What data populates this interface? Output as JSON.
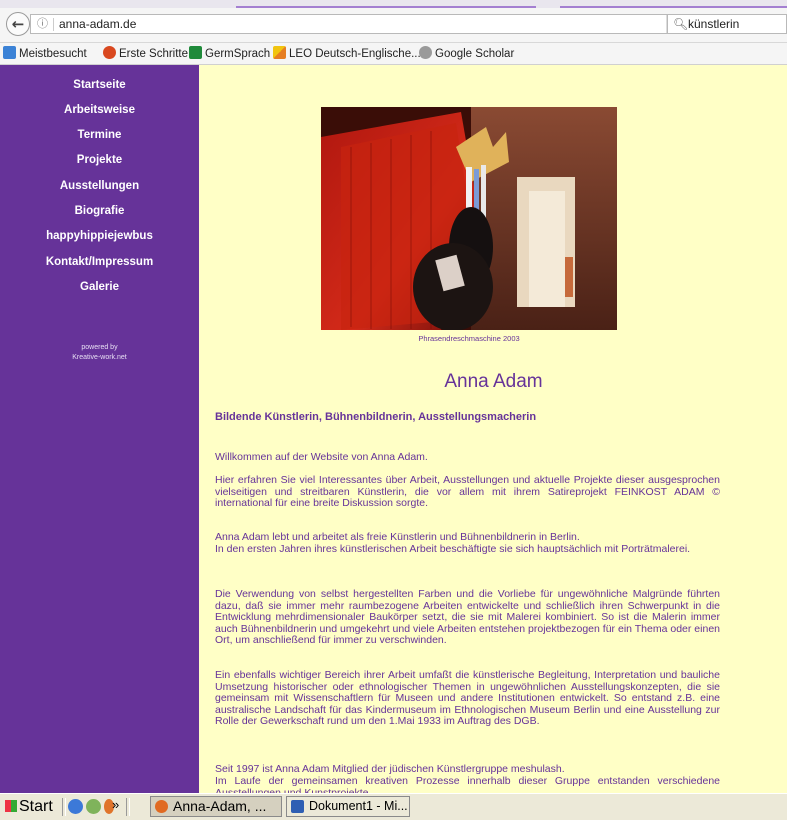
{
  "browser": {
    "url": "anna-adam.de",
    "search_value": "künstlerin",
    "bookmarks": [
      "Meistbesucht",
      "Erste Schritte",
      "GermSprach",
      "LEO Deutsch-Englische...",
      "Google Scholar"
    ]
  },
  "sidebar": {
    "items": [
      "Startseite",
      "Arbeitsweise",
      "Termine",
      "Projekte",
      "Ausstellungen",
      "Biografie",
      "happyhippiejewbus",
      "Kontakt/Impressum",
      "Galerie"
    ],
    "powered_by_1": "powered by",
    "powered_by_2": "Kreative-work.net"
  },
  "main": {
    "caption": "Phrasendreschmaschine 2003",
    "title": "Anna Adam",
    "subtitle": "Bildende Künstlerin, Bühnenbildnerin, Ausstellungsmacherin",
    "paragraphs": [
      "Willkommen auf der Website von Anna Adam.",
      "Hier erfahren Sie viel Interessantes über Arbeit, Ausstellungen und aktuelle Projekte dieser ausgesprochen vielseitigen und streitbaren Künstlerin, die vor allem mit ihrem Satireprojekt FEINKOST ADAM © international für eine breite Diskussion sorgte.",
      "Anna Adam lebt und arbeitet als freie Künstlerin und Bühnenbildnerin in Berlin.",
      "In den ersten Jahren ihres künstlerischen Arbeit beschäftigte sie sich hauptsächlich mit Porträtmalerei.",
      "Die Verwendung von selbst hergestellten Farben und die Vorliebe für ungewöhnliche Malgründe führten dazu, daß sie immer mehr raumbezogene Arbeiten entwickelte und schließlich ihren Schwerpunkt in die Entwicklung mehrdimensionaler Baukörper setzt, die sie mit Malerei kombiniert. So ist die Malerin immer auch Bühnenbildnerin und umgekehrt und viele Arbeiten entstehen projektbezogen für ein Thema oder einen Ort, um anschließend für immer zu verschwinden.",
      "Ein ebenfalls wichtiger Bereich ihrer Arbeit umfaßt die künstlerische Begleitung, Interpretation und bauliche Umsetzung historischer oder ethnologischer Themen in ungewöhnlichen Ausstellungskonzepten, die sie gemeinsam mit Wissenschaftlern für Museen und andere Institutionen entwickelt. So entstand z.B. eine australische Landschaft für das Kindermuseum im Ethnologischen Museum Berlin und eine Ausstellung zur Rolle der Gewerkschaft rund um den 1.Mai 1933 im Auftrag des DGB.",
      "Seit 1997 ist Anna Adam Mitglied der jüdischen Künstlergruppe meshulash.",
      "Im Laufe der gemeinsamen kreativen Prozesse innerhalb dieser Gruppe entstanden verschiedene Ausstellungen und Kunstprojekte"
    ]
  },
  "taskbar": {
    "start": "Start",
    "chevron": "»",
    "tasks": [
      "Anna-Adam, ...",
      "Dokument1 - Mi..."
    ]
  },
  "colors": {
    "sidebar": "#663399",
    "page_bg": "#ffffc6",
    "text": "#663399"
  }
}
